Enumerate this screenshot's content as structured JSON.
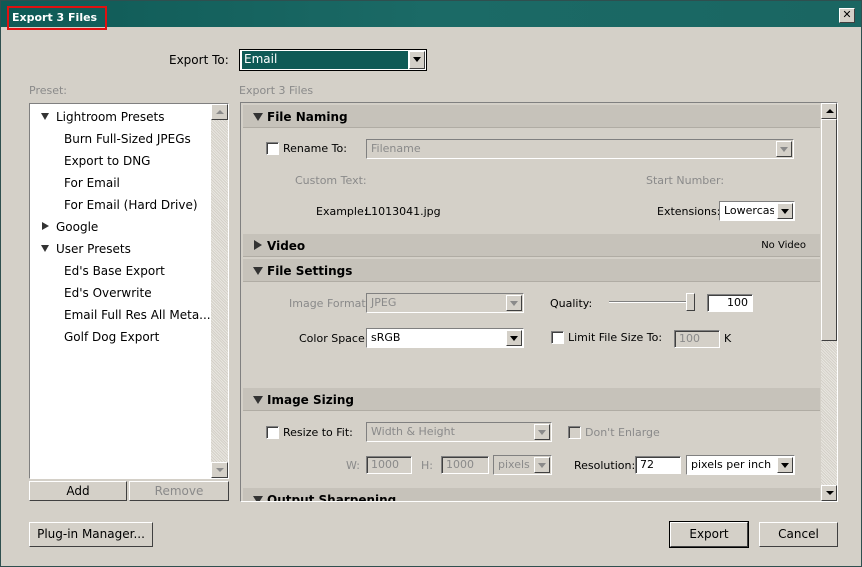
{
  "window": {
    "title": "Export 3 Files",
    "close_glyph": "✕"
  },
  "export_to": {
    "label": "Export To:",
    "value": "Email"
  },
  "preset": {
    "label": "Preset:",
    "groups": [
      {
        "name": "Lightroom Presets",
        "expanded": true,
        "items": [
          "Burn Full-Sized JPEGs",
          "Export to DNG",
          "For Email",
          "For Email (Hard Drive)"
        ]
      },
      {
        "name": "Google",
        "expanded": false,
        "items": []
      },
      {
        "name": "User Presets",
        "expanded": true,
        "items": [
          "Ed's Base Export",
          "Ed's Overwrite",
          "Email Full Res All Meta...",
          "Golf Dog Export"
        ]
      }
    ],
    "add_label": "Add",
    "remove_label": "Remove"
  },
  "settings": {
    "heading": "Export 3 Files",
    "file_naming": {
      "title": "File Naming",
      "rename_label": "Rename To:",
      "rename_value": "Filename",
      "custom_text_label": "Custom Text:",
      "start_number_label": "Start Number:",
      "example_label": "Example:",
      "example_value": "L1013041.jpg",
      "extensions_label": "Extensions:",
      "extensions_value": "Lowercase"
    },
    "video": {
      "title": "Video",
      "status": "No Video"
    },
    "file_settings": {
      "title": "File Settings",
      "image_format_label": "Image Format:",
      "image_format_value": "JPEG",
      "quality_label": "Quality:",
      "quality_value": "100",
      "quality_fraction": 1.0,
      "color_space_label": "Color Space:",
      "color_space_value": "sRGB",
      "limit_label": "Limit File Size To:",
      "limit_value": "100",
      "limit_unit": "K"
    },
    "image_sizing": {
      "title": "Image Sizing",
      "resize_label": "Resize to Fit:",
      "resize_value": "Width & Height",
      "dont_enlarge_label": "Don't Enlarge",
      "w_label": "W:",
      "w_value": "1000",
      "h_label": "H:",
      "h_value": "1000",
      "unit_value": "pixels",
      "resolution_label": "Resolution:",
      "resolution_value": "72",
      "resolution_unit": "pixels per inch"
    },
    "output_sharpening": {
      "title": "Output Sharpening"
    }
  },
  "footer": {
    "plugin_manager_label": "Plug-in Manager...",
    "export_label": "Export",
    "cancel_label": "Cancel"
  },
  "colors": {
    "titlebar": "#0f5a56",
    "title_highlight_border": "#e01010",
    "dialog_bg": "#d4d0c8",
    "selected_combo_bg": "#0f5a56"
  }
}
